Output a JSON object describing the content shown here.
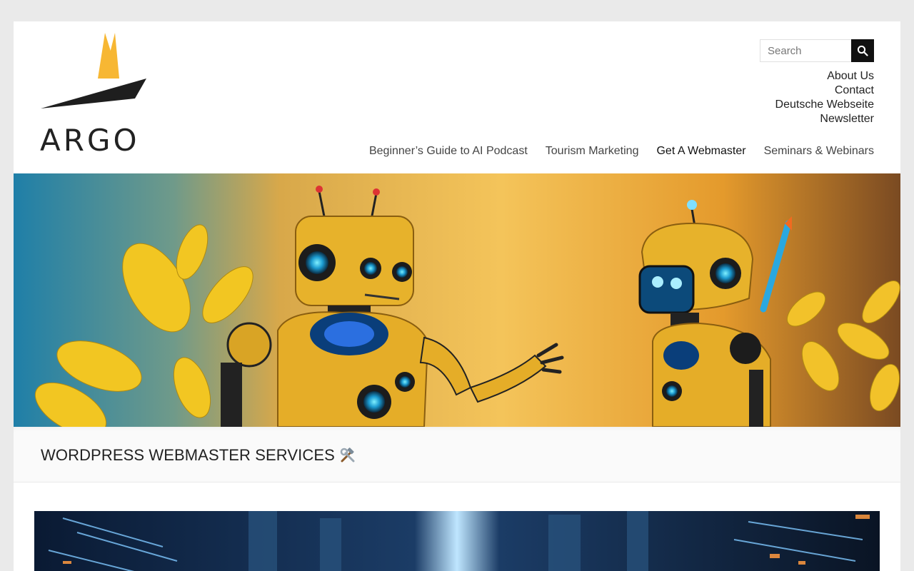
{
  "logo": {
    "text": "ARGO",
    "icon": "sail-logo-icon"
  },
  "search": {
    "placeholder": "Search",
    "icon": "search-icon"
  },
  "top_links": [
    "About Us",
    "Contact",
    "Deutsche Webseite",
    "Newsletter"
  ],
  "main_nav": {
    "items": [
      "Beginner’s Guide to AI Podcast",
      "Tourism Marketing",
      "Get A Webmaster",
      "Seminars & Webinars"
    ],
    "active": "Get A Webmaster"
  },
  "banner": {
    "image": "robots-with-yellow-leaves"
  },
  "page_title": {
    "text": "WORDPRESS WEBMASTER SERVICES",
    "icon": "hammer-and-wrench-icon"
  },
  "content_image": {
    "image": "futuristic-city-blue-lights"
  },
  "colors": {
    "logo_yellow": "#f7b733",
    "logo_dark": "#1e1e1e",
    "search_button": "#111111",
    "banner_orange": "#f2a93b",
    "banner_blue": "#1f7fa8"
  }
}
